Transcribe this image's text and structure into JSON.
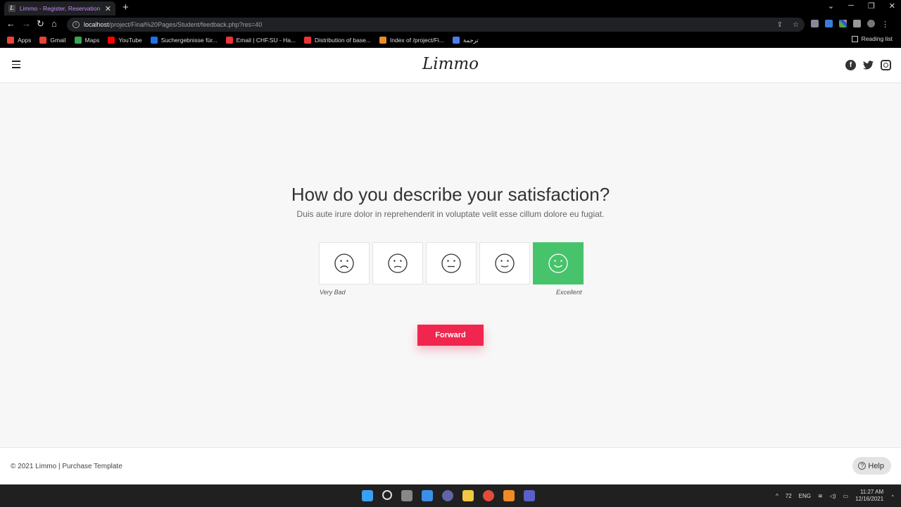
{
  "browser": {
    "tab_title": "Limmo - Register, Reservation, O",
    "url_host": "localhost",
    "url_path": "/project/Final%20Pages/Student/feedback.php?res=40",
    "bookmarks": [
      "Apps",
      "Gmail",
      "Maps",
      "YouTube",
      "Suchergebnisse für...",
      "Email | CHF.SU - Ha...",
      "Distribution of base...",
      "Index of /project/Fi...",
      "ترجمة"
    ],
    "bookmark_colors": [
      "#e8453c",
      "#ea4335",
      "#34a853",
      "#ff0000",
      "#1a73e8",
      "#e33",
      "#e33",
      "#f08a24",
      "#4a7ff0"
    ],
    "reading_list": "Reading list"
  },
  "site": {
    "logo": "Limmo",
    "menu_icon": "hamburger-icon",
    "socials": [
      "facebook-icon",
      "twitter-icon",
      "instagram-icon"
    ]
  },
  "feedback": {
    "title": "How do you describe your satisfaction?",
    "subtitle": "Duis aute irure dolor in reprehenderit in voluptate velit esse cillum dolore eu fugiat.",
    "options": [
      "very-sad-face-icon",
      "sad-face-icon",
      "neutral-face-icon",
      "smile-face-icon",
      "happy-face-icon"
    ],
    "selected_index": 4,
    "label_low": "Very Bad",
    "label_high": "Excellent",
    "selected_color": "#47c36b",
    "button_label": "Forward",
    "button_color": "#f1264e"
  },
  "footer": {
    "copyright": "© 2021 Limmo | Purchase Template",
    "help_label": "Help"
  },
  "taskbar": {
    "temperature": "72",
    "language": "ENG",
    "time": "11:27 AM",
    "date": "12/16/2021"
  }
}
